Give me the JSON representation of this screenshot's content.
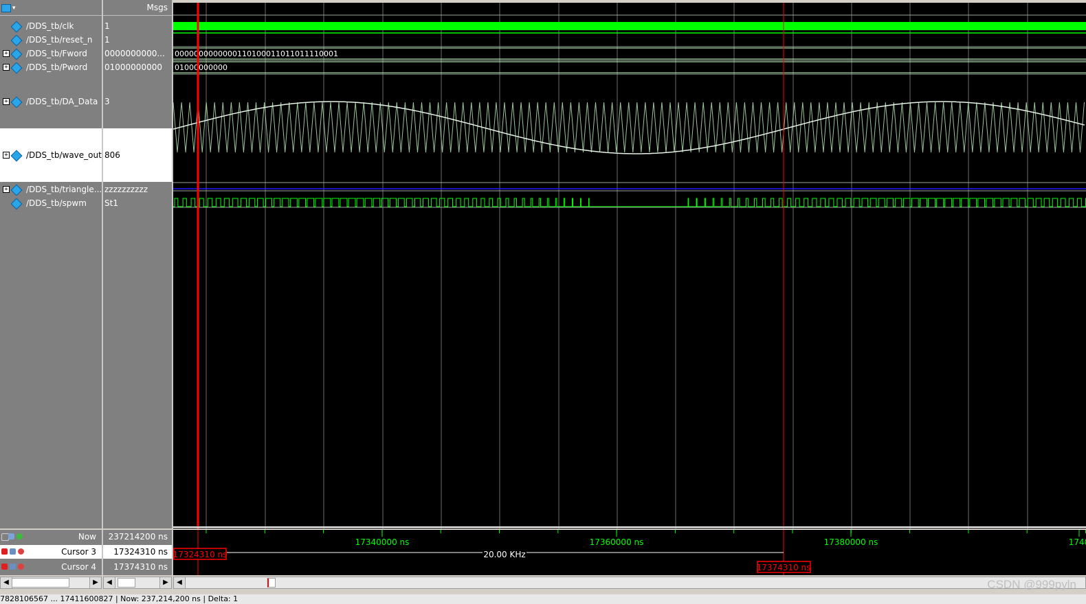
{
  "header": {
    "msgs_label": "Msgs"
  },
  "signals": [
    {
      "name": "/DDS_tb/clk",
      "value": "1",
      "expandable": false
    },
    {
      "name": "/DDS_tb/reset_n",
      "value": "1",
      "expandable": false
    },
    {
      "name": "/DDS_tb/Fword",
      "value": "0000000000...",
      "expandable": true,
      "bus_text": "0000000000000110100011011011110001"
    },
    {
      "name": "/DDS_tb/Pword",
      "value": "01000000000",
      "expandable": true,
      "bus_text": "01000000000"
    },
    {
      "name": "/DDS_tb/DA_Data",
      "value": "3",
      "expandable": true
    },
    {
      "name": "/DDS_tb/wave_out",
      "value": "806",
      "expandable": true
    },
    {
      "name": "/DDS_tb/triangle...",
      "value": "zzzzzzzzzz",
      "expandable": true
    },
    {
      "name": "/DDS_tb/spwm",
      "value": "St1",
      "expandable": false
    }
  ],
  "bottom": {
    "now_label": "Now",
    "now_value": "237214200 ns",
    "cursors": [
      {
        "name": "Cursor 3",
        "value": "17324310 ns",
        "tag": "17324310 ns"
      },
      {
        "name": "Cursor 4",
        "value": "17374310 ns",
        "tag": "17374310 ns"
      }
    ],
    "delta_label": "20.00 KHz"
  },
  "timeline": {
    "ticks": [
      "17340000 ns",
      "17360000 ns",
      "17380000 ns",
      "1740"
    ]
  },
  "status": {
    "text": "7828106567 ... 17411600827 | Now: 237,214,200 ns | Delta: 1"
  },
  "watermark": "CSDN @999pyln",
  "colors": {
    "clk": "#00ff00",
    "sine": "#e6f5e6",
    "bus": "#c0ffc0",
    "cursor": "#ff0000",
    "grid": "#6e6e6e",
    "triangle": "#1a1aff"
  }
}
